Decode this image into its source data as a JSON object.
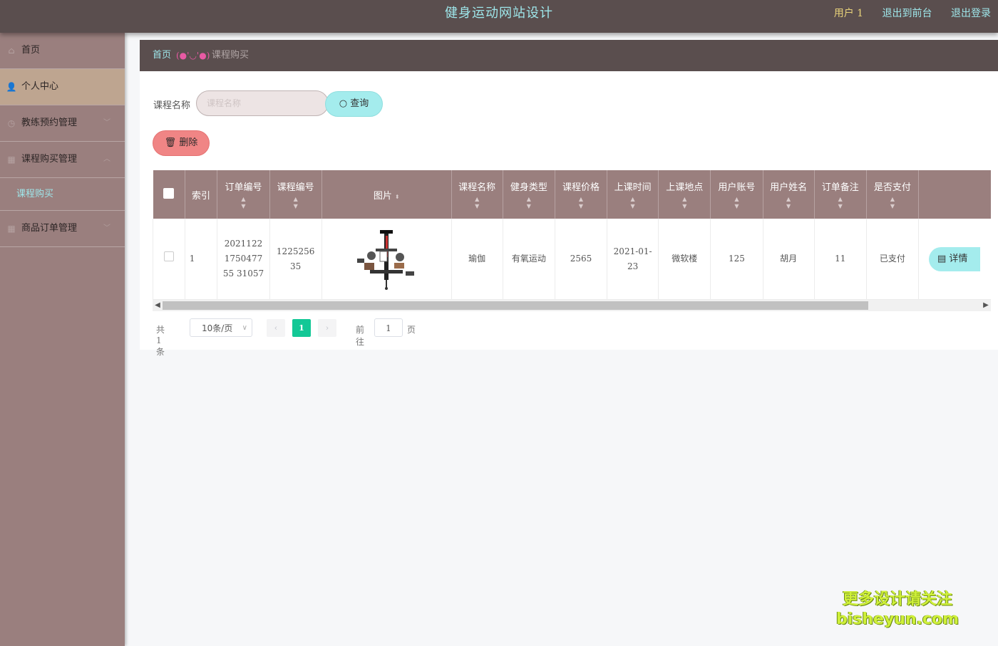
{
  "header": {
    "title": "健身运动网站设计",
    "user": "用户 1",
    "links": [
      "退出到前台",
      "退出登录"
    ]
  },
  "sidebar": {
    "items": [
      {
        "label": "首页",
        "icon": "home-icon"
      },
      {
        "label": "个人中心",
        "icon": "user-icon",
        "active": true
      },
      {
        "label": "教练预约管理",
        "icon": "clock-icon",
        "expandable": true
      },
      {
        "label": "课程购买管理",
        "icon": "grid-icon",
        "expandable": true,
        "expanded": true
      },
      {
        "label": "商品订单管理",
        "icon": "grid-icon",
        "expandable": true
      }
    ],
    "sub_item": "课程购买"
  },
  "breadcrumb": {
    "home": "首页",
    "separator": "(●'◡'●)",
    "current": "课程购买"
  },
  "search": {
    "label": "课程名称",
    "placeholder": "课程名称",
    "button": "查询"
  },
  "actions": {
    "delete": "删除"
  },
  "table": {
    "columns": [
      "索引",
      "订单编号",
      "课程编号",
      "图片",
      "课程名称",
      "健身类型",
      "课程价格",
      "上课时间",
      "上课地点",
      "用户账号",
      "用户姓名",
      "订单备注",
      "是否支付"
    ],
    "rows": [
      {
        "index": "1",
        "order_no": "2021122175047755 31057",
        "course_no": "122525635",
        "course_name": "瑜伽",
        "fitness_type": "有氧运动",
        "price": "2565",
        "class_time": "2021-01-23",
        "location": "微软楼",
        "account": "125",
        "user_name": "胡月",
        "remark": "11",
        "paid": "已支付",
        "detail_button": "详情"
      }
    ]
  },
  "pagination": {
    "total": "共 1 条",
    "page_size": "10条/页",
    "current_page": "1",
    "goto_label": "前往",
    "goto_value": "1",
    "page_unit": "页"
  },
  "watermark": {
    "line1": "更多设计请关注",
    "line2": "bisheyun.com"
  }
}
